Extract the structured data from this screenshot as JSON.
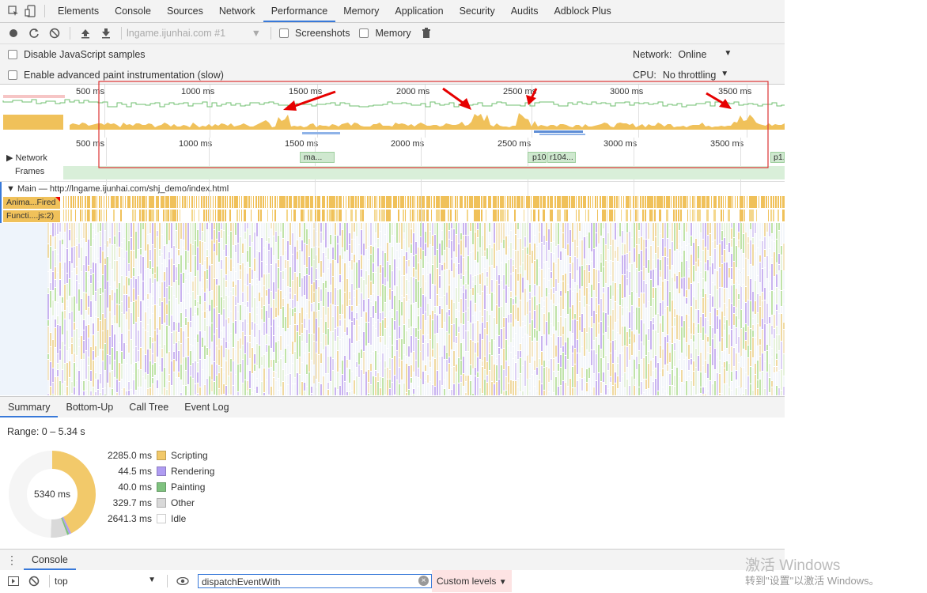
{
  "tabs": [
    "Elements",
    "Console",
    "Sources",
    "Network",
    "Performance",
    "Memory",
    "Application",
    "Security",
    "Audits",
    "Adblock Plus"
  ],
  "active_tab": "Performance",
  "toolbar": {
    "page_select": "lngame.ijunhai.com #1",
    "screenshots_label": "Screenshots",
    "memory_label": "Memory"
  },
  "settings": {
    "disable_js_samples": "Disable JavaScript samples",
    "advanced_paint": "Enable advanced paint instrumentation (slow)",
    "network_label": "Network:",
    "network_value": "Online",
    "cpu_label": "CPU:",
    "cpu_value": "No throttling"
  },
  "overview_ticks": [
    "500 ms",
    "1000 ms",
    "1500 ms",
    "2000 ms",
    "2500 ms",
    "3000 ms",
    "3500 ms"
  ],
  "timeline_ticks": [
    "500 ms",
    "1000 ms",
    "1500 ms",
    "2000 ms",
    "2500 ms",
    "3000 ms",
    "3500 ms"
  ],
  "tracks": {
    "network": "Network",
    "frames": "Frames",
    "main": "Main — http://lngame.ijunhai.com/shj_demo/index.html",
    "net_items": [
      "ma...",
      "p10",
      "r104...",
      "p1."
    ],
    "flame_labels": [
      "Anima...Fired",
      "Functi....js:2)"
    ]
  },
  "bottom_tabs": [
    "Summary",
    "Bottom-Up",
    "Call Tree",
    "Event Log"
  ],
  "active_bottom_tab": "Summary",
  "summary": {
    "range": "Range: 0 – 5.34 s",
    "total": "5340 ms",
    "items": [
      {
        "value": "2285.0 ms",
        "label": "Scripting",
        "color": "#f2c96a"
      },
      {
        "value": "44.5 ms",
        "label": "Rendering",
        "color": "#af9cf2"
      },
      {
        "value": "40.0 ms",
        "label": "Painting",
        "color": "#7fc27f"
      },
      {
        "value": "329.7 ms",
        "label": "Other",
        "color": "#d9d9d9"
      },
      {
        "value": "2641.3 ms",
        "label": "Idle",
        "color": "#ffffff"
      }
    ]
  },
  "console": {
    "tab": "Console",
    "context": "top",
    "filter": "dispatchEventWith",
    "levels": "Custom levels"
  },
  "watermark": {
    "line1": "激活 Windows",
    "line2": "转到\"设置\"以激活 Windows。"
  }
}
